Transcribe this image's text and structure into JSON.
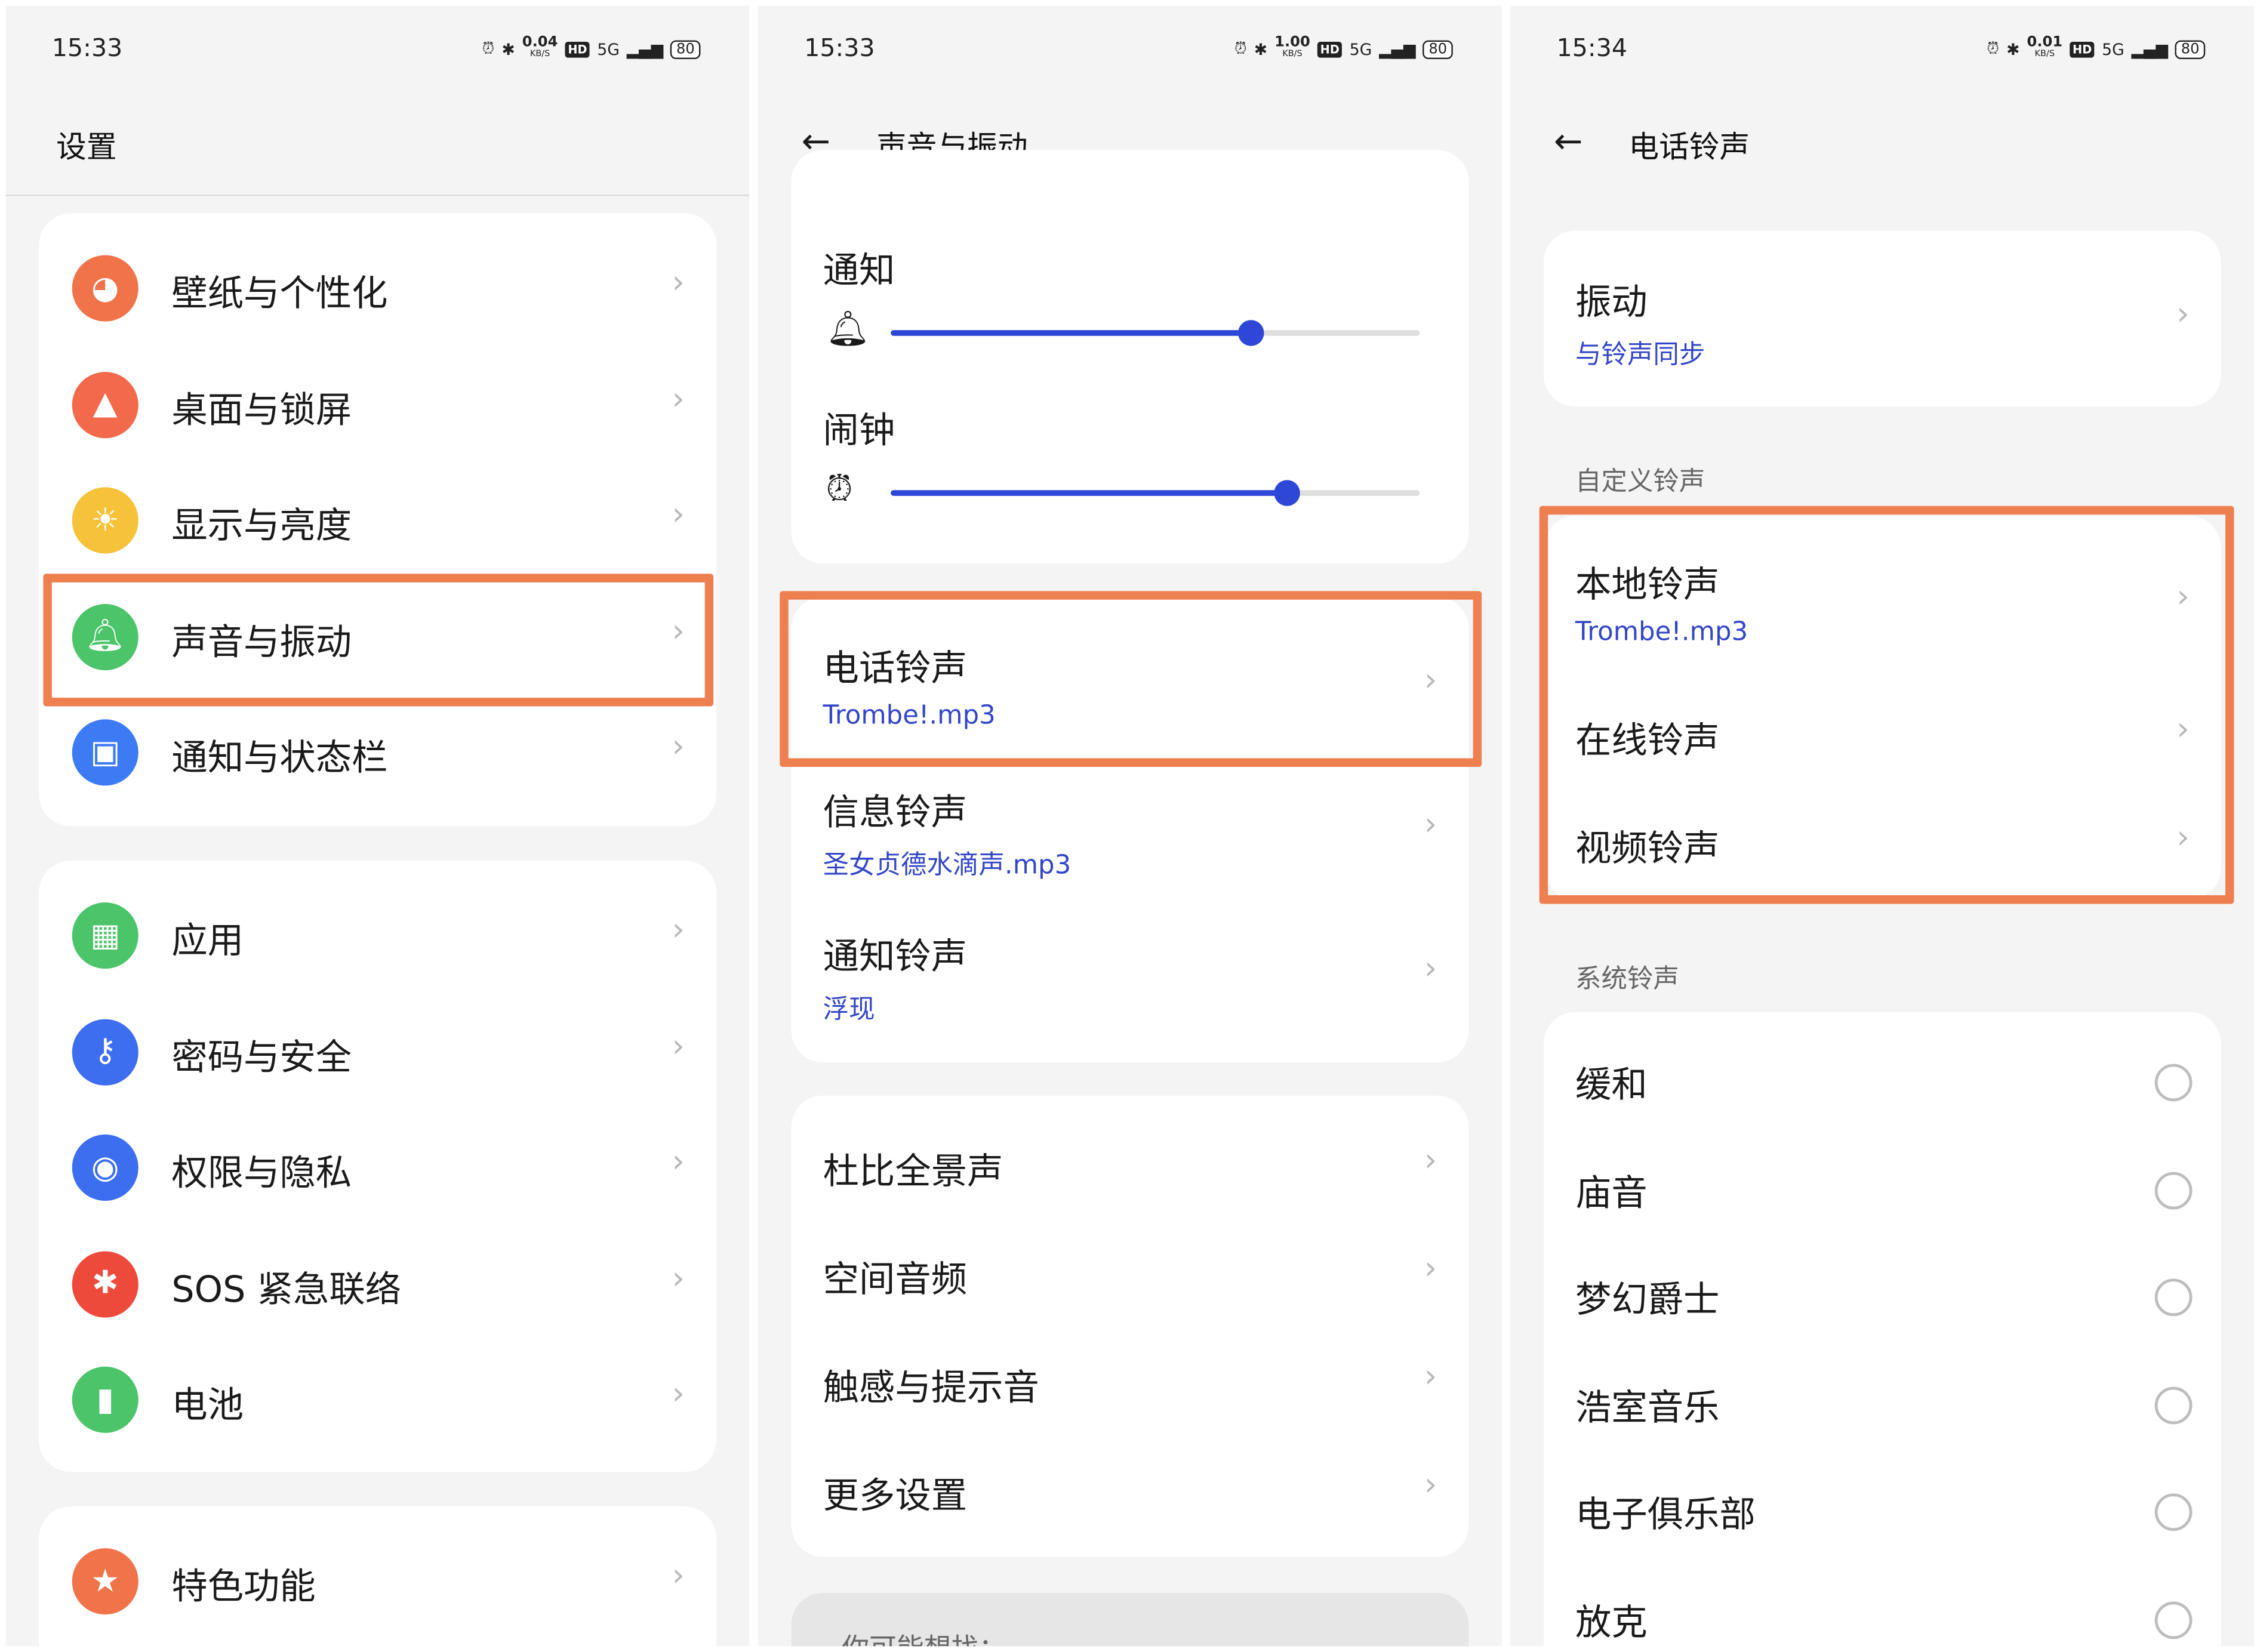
{
  "panels": [
    {
      "time": "15:33",
      "speed": "0.04",
      "speed_unit": "KB/S",
      "network": "5G",
      "hd": "HD",
      "battery": "80",
      "title": "设置"
    },
    {
      "time": "15:33",
      "speed": "1.00",
      "speed_unit": "KB/S",
      "network": "5G",
      "hd": "HD",
      "battery": "80",
      "title": "声音与振动"
    },
    {
      "time": "15:34",
      "speed": "0.01",
      "speed_unit": "KB/S",
      "network": "5G",
      "hd": "HD",
      "battery": "80",
      "title": "电话铃声"
    }
  ],
  "settings": {
    "groups": [
      [
        {
          "label": "壁纸与个性化",
          "icon": "palette-icon",
          "glyph": "◕",
          "color": "#f0734a"
        },
        {
          "label": "桌面与锁屏",
          "icon": "image-icon",
          "glyph": "▲",
          "color": "#f26a4b"
        },
        {
          "label": "显示与亮度",
          "icon": "sun-icon",
          "glyph": "☀",
          "color": "#f5c23a"
        },
        {
          "label": "声音与振动",
          "icon": "bell-icon",
          "glyph": "🔔︎",
          "color": "#4cc46a"
        },
        {
          "label": "通知与状态栏",
          "icon": "notification-icon",
          "glyph": "▣",
          "color": "#3d7bf5"
        }
      ],
      [
        {
          "label": "应用",
          "icon": "apps-icon",
          "glyph": "▦",
          "color": "#4cc46a"
        },
        {
          "label": "密码与安全",
          "icon": "key-icon",
          "glyph": "⚷",
          "color": "#3d6ef0"
        },
        {
          "label": "权限与隐私",
          "icon": "eye-lock-icon",
          "glyph": "◉",
          "color": "#3d6ef0"
        },
        {
          "label": "SOS 紧急联络",
          "icon": "asterisk-icon",
          "glyph": "✱",
          "color": "#ee4a3c"
        },
        {
          "label": "电池",
          "icon": "battery-icon",
          "glyph": "▮",
          "color": "#4cc46a"
        }
      ],
      [
        {
          "label": "特色功能",
          "icon": "star-icon",
          "glyph": "★",
          "color": "#f0734a"
        }
      ]
    ]
  },
  "sound": {
    "volumes": [
      {
        "label": "通知",
        "icon": "bell-icon",
        "glyph": "🔔︎",
        "level": 0.68
      },
      {
        "label": "闹钟",
        "icon": "alarm-icon",
        "glyph": "⏰︎",
        "level": 0.75
      }
    ],
    "ringtones": [
      {
        "label": "电话铃声",
        "value": "Trombe!.mp3"
      },
      {
        "label": "信息铃声",
        "value": "圣女贞德水滴声.mp3"
      },
      {
        "label": "通知铃声",
        "value": "浮现"
      }
    ],
    "more": [
      "杜比全景声",
      "空间音频",
      "触感与提示音",
      "更多设置"
    ],
    "suggest": "你可能想找："
  },
  "ringtone": {
    "vibration": {
      "label": "振动",
      "value": "与铃声同步"
    },
    "custom_header": "自定义铃声",
    "custom": [
      {
        "label": "本地铃声",
        "value": "Trombe!.mp3"
      },
      {
        "label": "在线铃声"
      },
      {
        "label": "视频铃声"
      }
    ],
    "system_header": "系统铃声",
    "system": [
      "缓和",
      "庙音",
      "梦幻爵士",
      "浩室音乐",
      "电子俱乐部",
      "放克"
    ]
  },
  "accent": "#ee8050"
}
